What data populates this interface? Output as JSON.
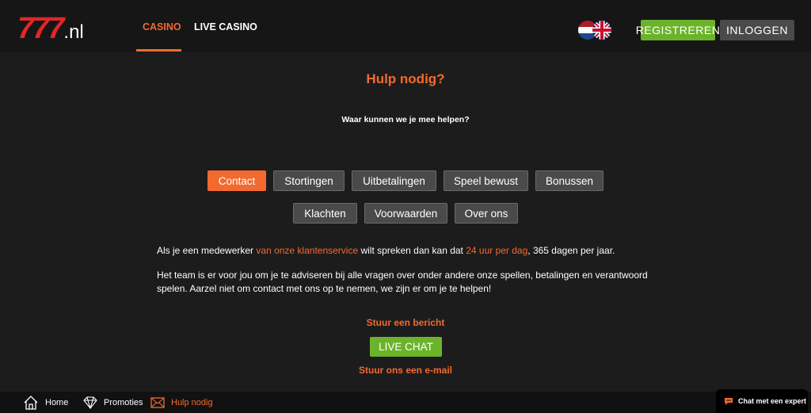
{
  "header": {
    "logo_number": "777",
    "logo_tld": ".nl",
    "nav": [
      {
        "label": "CASINO",
        "active": true
      },
      {
        "label": "LIVE CASINO",
        "active": false
      }
    ],
    "register_label": "REGISTREREN",
    "login_label": "INLOGGEN"
  },
  "help": {
    "title": "Hulp nodig?",
    "subtitle": "Waar kunnen we je mee helpen?",
    "categories_row1": [
      "Contact",
      "Stortingen",
      "Uitbetalingen",
      "Speel bewust",
      "Bonussen"
    ],
    "categories_row2": [
      "Klachten",
      "Voorwaarden",
      "Over ons"
    ],
    "active_category": "Contact",
    "para1": {
      "before": "Als je een medewerker ",
      "link": "van onze klantenservice",
      "middle": " wilt spreken dan kan dat ",
      "highlight": "24 uur per dag",
      "after": ", 365 dagen per jaar."
    },
    "para2": "Het team is er voor jou om je te adviseren bij alle vragen over onder andere onze spellen, betalingen en verantwoord spelen. Aarzel niet om contact met ons op te nemen, we zijn er om je te helpen!",
    "send_message": "Stuur een bericht",
    "live_chat": "LIVE CHAT",
    "send_email": "Stuur ons een e-mail"
  },
  "bottom_nav": [
    {
      "label": "Home",
      "icon": "house-icon",
      "active": false
    },
    {
      "label": "Promoties",
      "icon": "diamond-icon",
      "active": false
    },
    {
      "label": "Hulp nodig",
      "icon": "envelope-icon",
      "active": true
    }
  ],
  "chat_widget": {
    "label": "Chat met een expert",
    "icon": "chat-bubble-icon"
  },
  "colors": {
    "accent": "#f26a30",
    "green": "#6cb32c",
    "background": "#1c1c1c",
    "button_grey": "#4a4a4a",
    "logo_red": "#e3262a"
  }
}
